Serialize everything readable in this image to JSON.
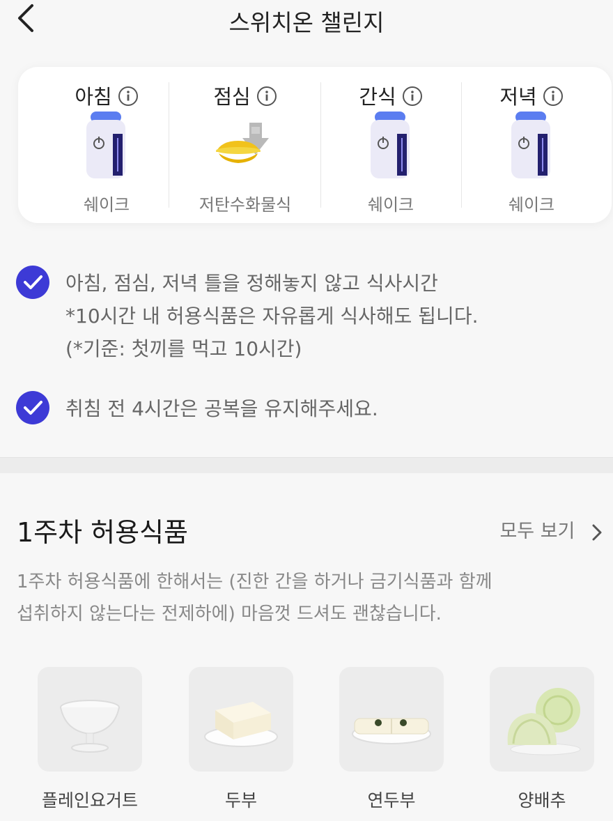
{
  "header": {
    "title": "스위치온 챌린지"
  },
  "meals": [
    {
      "name": "아침",
      "food": "쉐이크"
    },
    {
      "name": "점심",
      "food": "저탄수화물식"
    },
    {
      "name": "간식",
      "food": "쉐이크"
    },
    {
      "name": "저녁",
      "food": "쉐이크"
    }
  ],
  "rules": [
    {
      "lines": [
        "아침, 점심, 저녁 틀을 정해놓지 않고 식사시간",
        "*10시간 내 허용식품은 자유롭게 식사해도 됩니다.",
        "(*기준: 첫끼를 먹고 10시간)"
      ]
    },
    {
      "lines": [
        "취침 전 4시간은 공복을 유지해주세요."
      ]
    }
  ],
  "allowed": {
    "title": "1주차 허용식품",
    "see_all": "모두 보기",
    "desc_lines": [
      "1주차 허용식품에 한해서는 (진한 간을 하거나 금기식품과 함께",
      "섭취하지 않는다는 전제하에) 마음껏 드셔도 괜찮습니다."
    ],
    "foods": [
      {
        "name": "플레인요거트"
      },
      {
        "name": "두부"
      },
      {
        "name": "연두부"
      },
      {
        "name": "양배추"
      }
    ]
  },
  "colors": {
    "check": "#3d3ad6",
    "shake_cap": "#5b7df0",
    "shake_label": "#23206e"
  }
}
